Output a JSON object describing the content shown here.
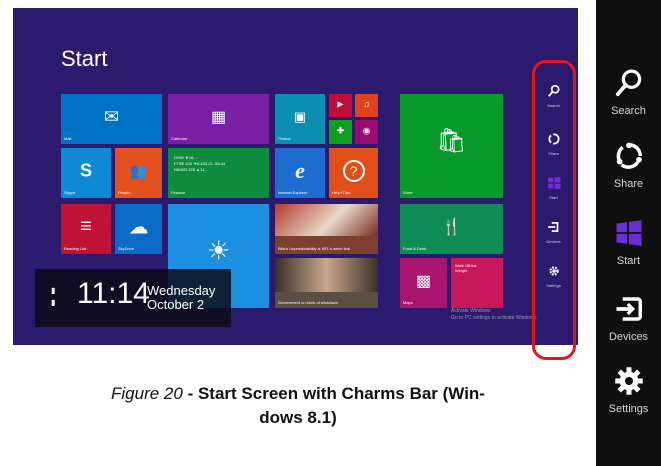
{
  "screen": {
    "title": "Start",
    "tiles": [
      {
        "id": "mail",
        "label": "Mail",
        "icon": "✉",
        "color": "#0072c6"
      },
      {
        "id": "calendar",
        "label": "Calendar",
        "icon": "▦",
        "color": "#7a1fa2"
      },
      {
        "id": "photos",
        "label": "Photos",
        "icon": "▣",
        "color": "#0b8fb1"
      },
      {
        "id": "video",
        "label": "",
        "icon": "▶",
        "color": "#c10c3a"
      },
      {
        "id": "music",
        "label": "",
        "icon": "♫",
        "color": "#e0421c"
      },
      {
        "id": "games",
        "label": "",
        "icon": "✚",
        "color": "#0d9e21"
      },
      {
        "id": "camera",
        "label": "",
        "icon": "◉",
        "color": "#9c0b6f"
      },
      {
        "id": "skype",
        "label": "Skype",
        "icon": "S",
        "color": "#0d89d6"
      },
      {
        "id": "people",
        "label": "People",
        "icon": "👥",
        "color": "#e3511c"
      },
      {
        "id": "finance",
        "label": "Finance",
        "icon": "",
        "color": "#0d8c3d"
      },
      {
        "id": "ie",
        "label": "Internet Explorer",
        "icon": "e",
        "color": "#1d6dd1"
      },
      {
        "id": "help",
        "label": "Help+Tips",
        "icon": "?",
        "color": "#e24e17"
      },
      {
        "id": "store",
        "label": "Store",
        "icon": "🛍",
        "color": "#0a9a2b"
      },
      {
        "id": "readinglist",
        "label": "Reading List",
        "icon": "≡",
        "color": "#c01234"
      },
      {
        "id": "skydrive",
        "label": "SkyDrive",
        "icon": "☁",
        "color": "#0a6cc6"
      },
      {
        "id": "weather",
        "label": "",
        "icon": "☀",
        "color": "#1d8fe0"
      },
      {
        "id": "sports",
        "label": "Bills's Unpredictability is NFL's weird link",
        "icon": "",
        "color": "#7b4030"
      },
      {
        "id": "fooddrink",
        "label": "Food & Drink",
        "icon": "🍴",
        "color": "#0e8c56"
      },
      {
        "id": "news",
        "label": "Government on brink of shutdown",
        "icon": "",
        "color": "#5b4f43"
      },
      {
        "id": "maps",
        "label": "Maps",
        "icon": "▩",
        "color": "#a8156f"
      },
      {
        "id": "walkoff",
        "label": "Walk Off the Weight",
        "icon": "",
        "color": "#c8185b"
      }
    ],
    "finance_text": [
      "DOW ▼15,...",
      "FTSE 100 ▼6,432.22 -55.44",
      "NIKKEI 225 ▲14,..."
    ],
    "lock": {
      "time": "11:14",
      "day": "Wednesday",
      "date": "October 2"
    },
    "watermark": [
      "Activate Windows",
      "Go to PC settings to activate Windows."
    ],
    "charms": [
      {
        "label": "Search",
        "icon": "search-icon"
      },
      {
        "label": "Share",
        "icon": "share-icon"
      },
      {
        "label": "Start",
        "icon": "windows-start-icon"
      },
      {
        "label": "Devices",
        "icon": "devices-icon"
      },
      {
        "label": "Settings",
        "icon": "settings-gear-icon"
      }
    ]
  },
  "charms_bar": {
    "items": [
      {
        "label": "Search",
        "icon": "search-icon"
      },
      {
        "label": "Share",
        "icon": "share-icon"
      },
      {
        "label": "Start",
        "icon": "windows-start-icon"
      },
      {
        "label": "Devices",
        "icon": "devices-icon"
      },
      {
        "label": "Settings",
        "icon": "settings-gear-icon"
      }
    ]
  },
  "caption": {
    "figure": "Figure 20",
    "sep": " - ",
    "text_line1": "Start Screen with Charms Bar (Win-",
    "text_line2": "dows 8.1)"
  },
  "colors": {
    "start_bg": "#2b1a6e",
    "highlight_ring": "#e2151d",
    "charms_bg": "#0f0f0f"
  }
}
